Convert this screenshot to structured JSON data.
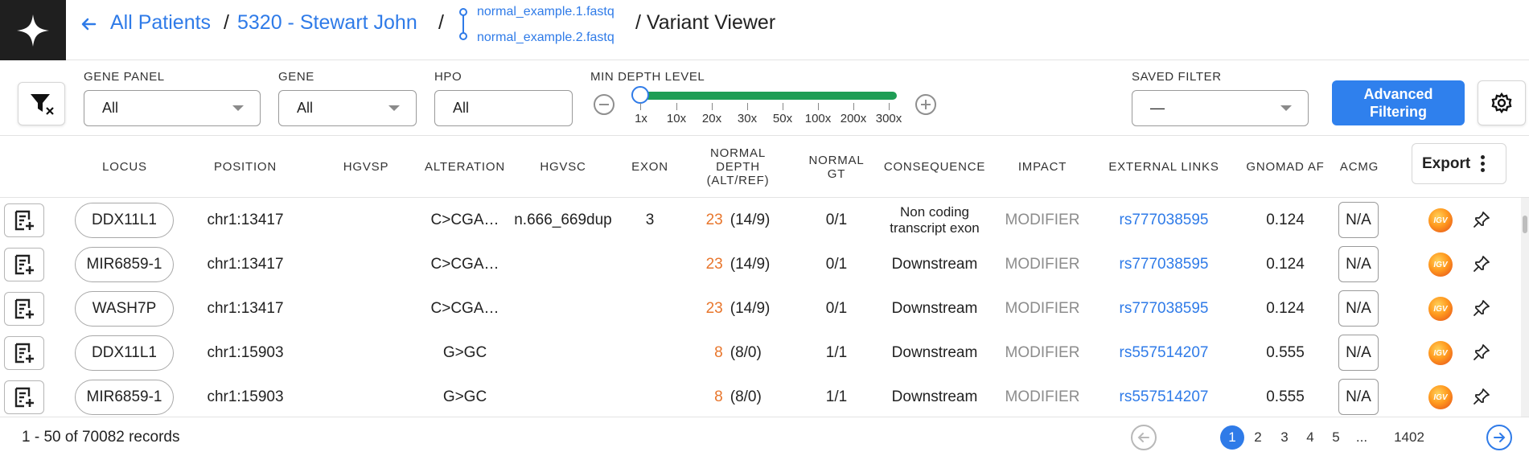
{
  "header": {
    "crumb_patients": "All Patients",
    "sep1": "/",
    "crumb_patient": "5320 - Stewart John",
    "sep2": "/",
    "fastq_files": [
      "normal_example.1.fastq",
      "normal_example.2.fastq"
    ],
    "page_title": "/ Variant Viewer"
  },
  "filters": {
    "gene_panel": {
      "label": "GENE PANEL",
      "value": "All"
    },
    "gene": {
      "label": "GENE",
      "value": "All"
    },
    "hpo": {
      "label": "HPO",
      "value": "All"
    },
    "min_depth": {
      "label": "MIN DEPTH LEVEL",
      "ticks": [
        "1x",
        "10x",
        "20x",
        "30x",
        "50x",
        "100x",
        "200x",
        "300x"
      ],
      "selected": "1x"
    },
    "saved_filter": {
      "label": "SAVED FILTER",
      "value": "—"
    },
    "advanced_label_line1": "Advanced",
    "advanced_label_line2": "Filtering"
  },
  "table": {
    "columns": {
      "locus": "LOCUS",
      "position": "POSITION",
      "hgvsp": "HGVSP",
      "alteration": "ALTERATION",
      "hgvsc": "HGVSC",
      "exon": "EXON",
      "normal_depth": [
        "NORMAL",
        "DEPTH",
        "(ALT/REF)"
      ],
      "normal_gt": [
        "NORMAL",
        "GT"
      ],
      "consequence": "CONSEQUENCE",
      "impact": "IMPACT",
      "external_links": "EXTERNAL LINKS",
      "gnomad_af": "GNOMAD AF",
      "acmg": "ACMG"
    },
    "export_label": "Export",
    "rows": [
      {
        "locus": "DDX11L1",
        "position": "chr1:13417",
        "hgvsp": "",
        "alteration": "C>CGA…",
        "hgvsc": "n.666_669dup",
        "exon": "3",
        "depth": "23",
        "alt_ref": "(14/9)",
        "gt": "0/1",
        "consequence": "Non coding transcript exon",
        "impact": "MODIFIER",
        "link": "rs777038595",
        "gnomad": "0.124",
        "acmg": "N/A"
      },
      {
        "locus": "MIR6859-1",
        "position": "chr1:13417",
        "hgvsp": "",
        "alteration": "C>CGA…",
        "hgvsc": "",
        "exon": "",
        "depth": "23",
        "alt_ref": "(14/9)",
        "gt": "0/1",
        "consequence": "Downstream",
        "impact": "MODIFIER",
        "link": "rs777038595",
        "gnomad": "0.124",
        "acmg": "N/A"
      },
      {
        "locus": "WASH7P",
        "position": "chr1:13417",
        "hgvsp": "",
        "alteration": "C>CGA…",
        "hgvsc": "",
        "exon": "",
        "depth": "23",
        "alt_ref": "(14/9)",
        "gt": "0/1",
        "consequence": "Downstream",
        "impact": "MODIFIER",
        "link": "rs777038595",
        "gnomad": "0.124",
        "acmg": "N/A"
      },
      {
        "locus": "DDX11L1",
        "position": "chr1:15903",
        "hgvsp": "",
        "alteration": "G>GC",
        "hgvsc": "",
        "exon": "",
        "depth": "8",
        "alt_ref": "(8/0)",
        "gt": "1/1",
        "consequence": "Downstream",
        "impact": "MODIFIER",
        "link": "rs557514207",
        "gnomad": "0.555",
        "acmg": "N/A"
      },
      {
        "locus": "MIR6859-1",
        "position": "chr1:15903",
        "hgvsp": "",
        "alteration": "G>GC",
        "hgvsc": "",
        "exon": "",
        "depth": "8",
        "alt_ref": "(8/0)",
        "gt": "1/1",
        "consequence": "Downstream",
        "impact": "MODIFIER",
        "link": "rs557514207",
        "gnomad": "0.555",
        "acmg": "N/A"
      }
    ]
  },
  "footer": {
    "records": "1 - 50 of 70082 records",
    "pages": [
      "1",
      "2",
      "3",
      "4",
      "5",
      "...",
      "1402"
    ],
    "current_page": "1"
  },
  "colors": {
    "accent": "#2f7be8",
    "slider": "#1f9d55",
    "depth": "#e8762c",
    "logo_bg": "#1f1f1f"
  },
  "icons": [
    "sparkle-logo-icon",
    "back-arrow-icon",
    "fastq-link-icon",
    "filter-clear-icon",
    "minus-circle-icon",
    "plus-circle-icon",
    "gear-icon",
    "kebab-icon",
    "add-note-icon",
    "igv-icon",
    "pin-icon",
    "prev-page-icon",
    "next-page-icon"
  ]
}
